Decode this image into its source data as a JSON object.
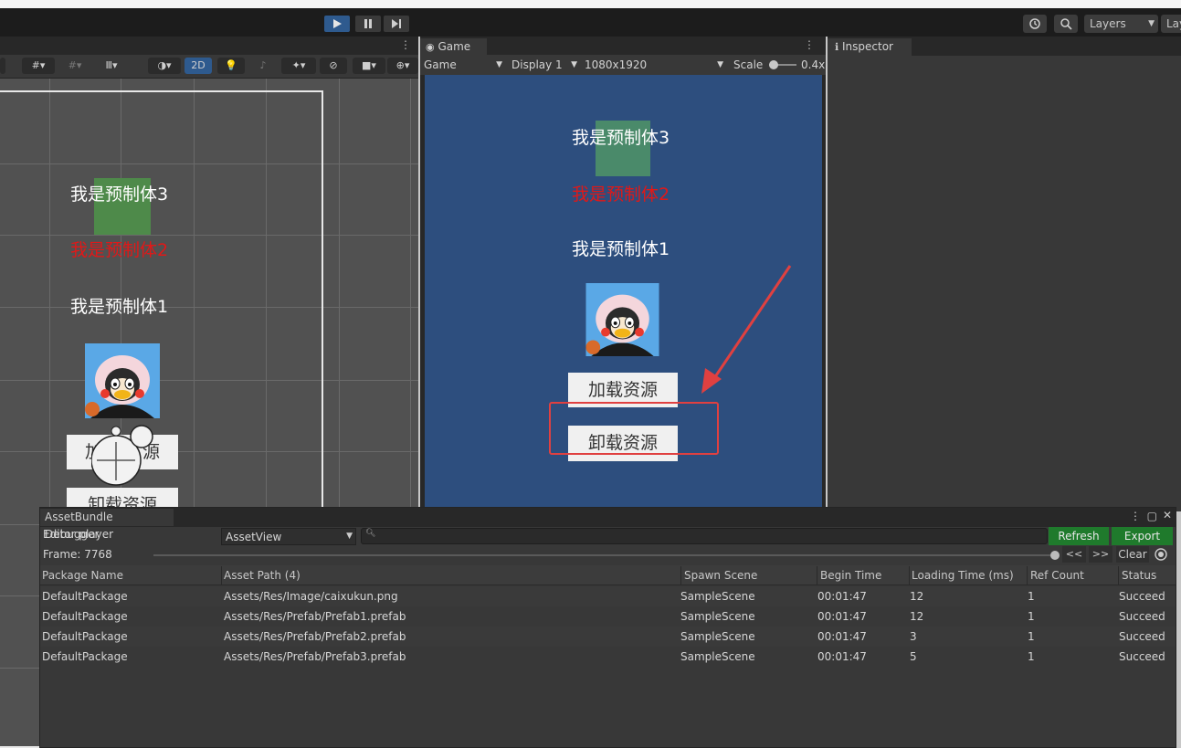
{
  "toolbar": {
    "play_icon": "play-icon",
    "pause_icon": "pause-icon",
    "step_icon": "step-icon",
    "history_icon": "history-icon",
    "search_icon": "search-icon",
    "layers_label": "Layers",
    "layout_label": "Lay"
  },
  "scene": {
    "toolbar_2d_label": "2D",
    "labels": {
      "prefab3": "我是预制体3",
      "prefab2": "我是预制体2",
      "prefab1": "我是预制体1"
    },
    "load_button_partial_left": "加",
    "load_button_partial_right": "源",
    "unload_button_partial": "卸载资源"
  },
  "game": {
    "tab_label": "Game",
    "mode": "Game",
    "display": "Display 1",
    "resolution": "1080x1920",
    "scale_label": "Scale",
    "scale_value": "0.4x",
    "labels": {
      "prefab3": "我是预制体3",
      "prefab2": "我是预制体2",
      "prefab1": "我是预制体1"
    },
    "load_button": "加载资源",
    "unload_button": "卸载资源"
  },
  "inspector": {
    "tab_label": "Inspector"
  },
  "debugger": {
    "tab_label": "AssetBundle Debugger",
    "player": "Editor player",
    "view_mode": "AssetView",
    "search_placeholder": "",
    "refresh_label": "Refresh",
    "export_label": "Export",
    "frame_label": "Frame: 7768",
    "prev_label": "<<",
    "next_label": ">>",
    "clear_label": "Clear",
    "columns": {
      "package": "Package Name",
      "path": "Asset Path (4)",
      "scene": "Spawn Scene",
      "begin": "Begin Time",
      "loading": "Loading Time (ms)",
      "ref": "Ref Count",
      "status": "Status"
    },
    "rows": [
      {
        "package": "DefaultPackage",
        "path": "Assets/Res/Image/caixukun.png",
        "scene": "SampleScene",
        "begin": "00:01:47",
        "loading": "12",
        "ref": "1",
        "status": "Succeed"
      },
      {
        "package": "DefaultPackage",
        "path": "Assets/Res/Prefab/Prefab1.prefab",
        "scene": "SampleScene",
        "begin": "00:01:47",
        "loading": "12",
        "ref": "1",
        "status": "Succeed"
      },
      {
        "package": "DefaultPackage",
        "path": "Assets/Res/Prefab/Prefab2.prefab",
        "scene": "SampleScene",
        "begin": "00:01:47",
        "loading": "3",
        "ref": "1",
        "status": "Succeed"
      },
      {
        "package": "DefaultPackage",
        "path": "Assets/Res/Prefab/Prefab3.prefab",
        "scene": "SampleScene",
        "begin": "00:01:47",
        "loading": "5",
        "ref": "1",
        "status": "Succeed"
      }
    ]
  },
  "colors": {
    "accent_blue": "#2e5a8e",
    "game_bg": "#2d4e7e",
    "green_square": "#4e8a4a",
    "red_text": "#e01818",
    "annotation_red": "#e04040",
    "button_green": "#1f7a2c"
  }
}
